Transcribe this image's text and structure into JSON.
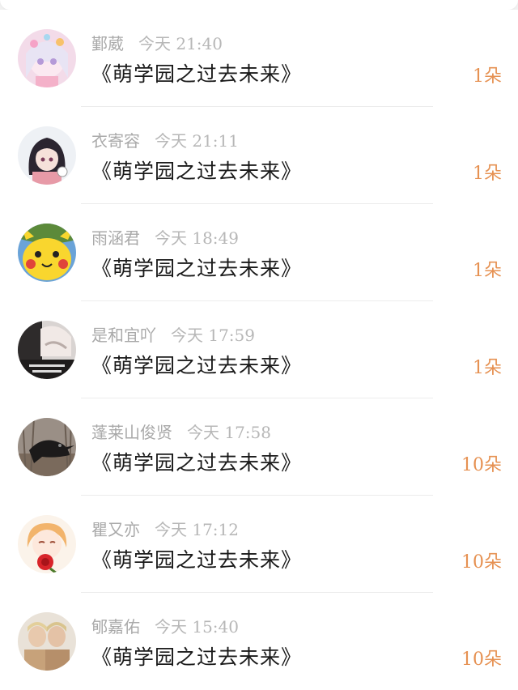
{
  "colors": {
    "background": "#ebebeb",
    "card": "#ffffff",
    "name_text": "#a9a9a9",
    "title_text": "#1a1a1a",
    "count_text": "#e69152"
  },
  "rows": [
    {
      "name": "鄞葳",
      "time": "今天 21:40",
      "title": "《萌学园之过去未来》",
      "count": "1朵",
      "avatar_icon": "anime-girl-avatar"
    },
    {
      "name": "衣寄容",
      "time": "今天 21:11",
      "title": "《萌学园之过去未来》",
      "count": "1朵",
      "avatar_icon": "dark-hair-girl-avatar"
    },
    {
      "name": "雨涵君",
      "time": "今天 18:49",
      "title": "《萌学园之过去未来》",
      "count": "1朵",
      "avatar_icon": "pikachu-avatar"
    },
    {
      "name": "是和宜吖",
      "time": "今天 17:59",
      "title": "《萌学园之过去未来》",
      "count": "1朵",
      "avatar_icon": "photo-collage-avatar"
    },
    {
      "name": "蓬莱山俊贤",
      "time": "今天 17:58",
      "title": "《萌学园之过去未来》",
      "count": "10朵",
      "avatar_icon": "crow-avatar"
    },
    {
      "name": "瞿又亦",
      "time": "今天 17:12",
      "title": "《萌学园之过去未来》",
      "count": "10朵",
      "avatar_icon": "rose-girl-avatar"
    },
    {
      "name": "郇嘉佑",
      "time": "今天 15:40",
      "title": "《萌学园之过去未来》",
      "count": "10朵",
      "avatar_icon": "two-people-avatar"
    }
  ]
}
